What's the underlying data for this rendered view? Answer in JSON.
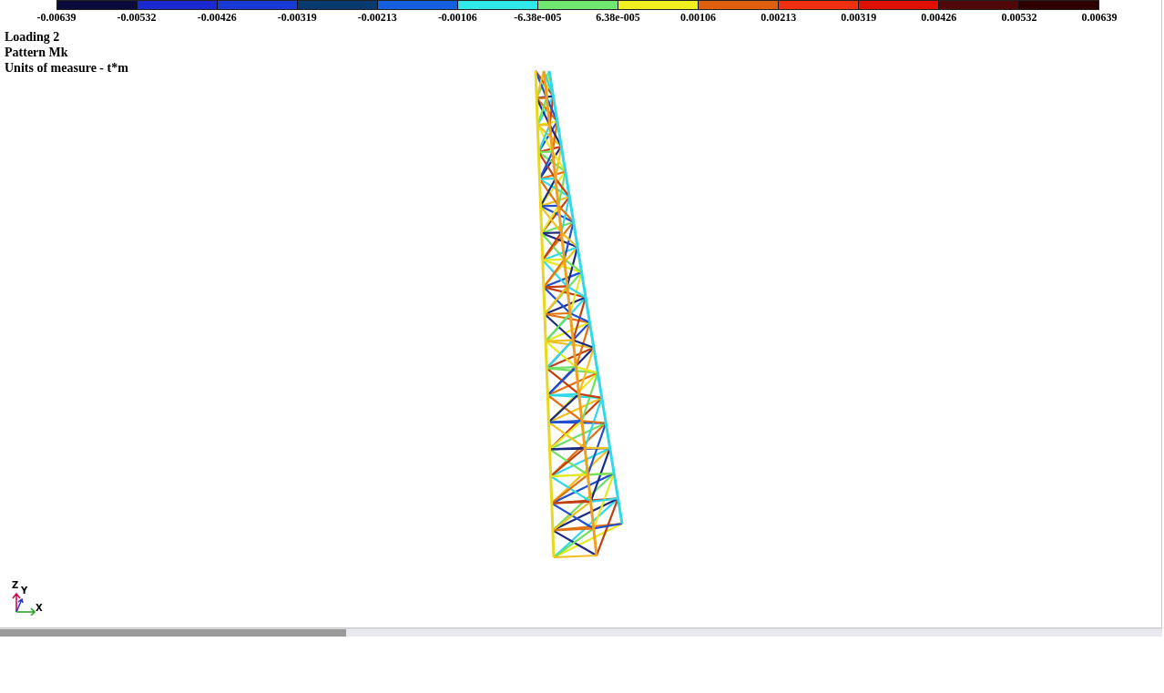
{
  "scale": {
    "segments": [
      {
        "color": "#0b0b3b"
      },
      {
        "color": "#1a2ad0"
      },
      {
        "color": "#1a3ad8"
      },
      {
        "color": "#083a70"
      },
      {
        "color": "#1560e0"
      },
      {
        "color": "#30e8e8"
      },
      {
        "color": "#70e870"
      },
      {
        "color": "#f0f020"
      },
      {
        "color": "#e06010"
      },
      {
        "color": "#f03010"
      },
      {
        "color": "#e01000"
      },
      {
        "color": "#500808"
      },
      {
        "color": "#300000"
      }
    ],
    "labels": [
      "-0.00639",
      "-0.00532",
      "-0.00426",
      "-0.00319",
      "-0.00213",
      "-0.00106",
      "-6.38e-005",
      "6.38e-005",
      "0.00106",
      "0.00213",
      "0.00319",
      "0.00426",
      "0.00532",
      "0.00639"
    ]
  },
  "info": [
    "Loading 2",
    "Pattern Mk",
    "Units of measure - t*m"
  ],
  "axes": {
    "z": "Z",
    "y": "Y",
    "x": "X"
  }
}
